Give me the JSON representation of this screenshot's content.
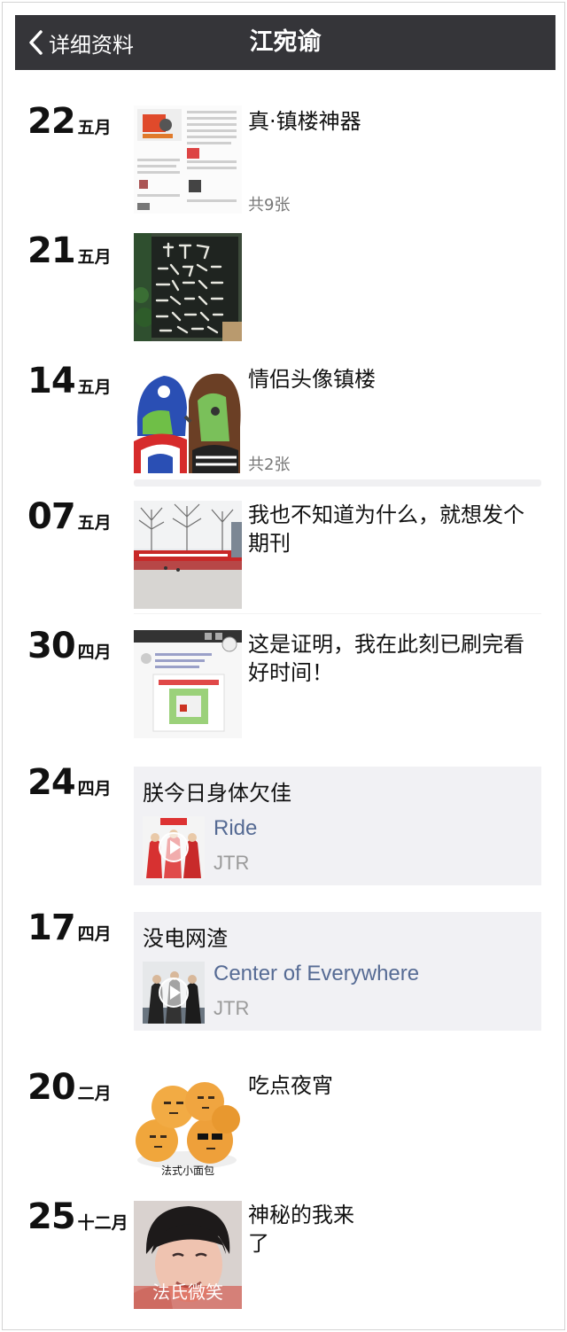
{
  "nav": {
    "back_label": "详细资料",
    "title": "江宛谕"
  },
  "posts": [
    {
      "day": "22",
      "month": "五月",
      "caption": "真·镇楼神器",
      "count": "共9张",
      "thumb": "screenshot-collage"
    },
    {
      "day": "21",
      "month": "五月",
      "caption": "",
      "thumb": "chalkboard-note"
    },
    {
      "day": "14",
      "month": "五月",
      "caption": "情侣头像镇楼",
      "count": "共2张",
      "thumb": "couple-avatar"
    },
    {
      "day": "07",
      "month": "五月",
      "caption": "我也不知道为什么，就想发个期刊",
      "thumb": "campus-banner"
    },
    {
      "day": "30",
      "month": "四月",
      "caption": "这是证明，我在此刻已刷完看好时间！",
      "thumb": "chat-screenshot"
    },
    {
      "day": "24",
      "month": "四月",
      "share_title": "朕今日身体欠佳",
      "song": "Ride",
      "artist": "JTR"
    },
    {
      "day": "17",
      "month": "四月",
      "share_title": "没电网渣",
      "song": "Center of Everywhere",
      "artist": "JTR"
    },
    {
      "day": "20",
      "month": "二月",
      "caption": "吃点夜宵",
      "thumb_text": "法式小面包",
      "thumb": "buns-meme"
    },
    {
      "day": "25",
      "month": "十二月",
      "caption": "神秘的我来了",
      "thumb_text": "法氏微笑",
      "thumb": "portrait-meme"
    }
  ],
  "colors": {
    "navbar": "#353539",
    "link": "#566b94",
    "share_bg": "#f1f1f4"
  }
}
